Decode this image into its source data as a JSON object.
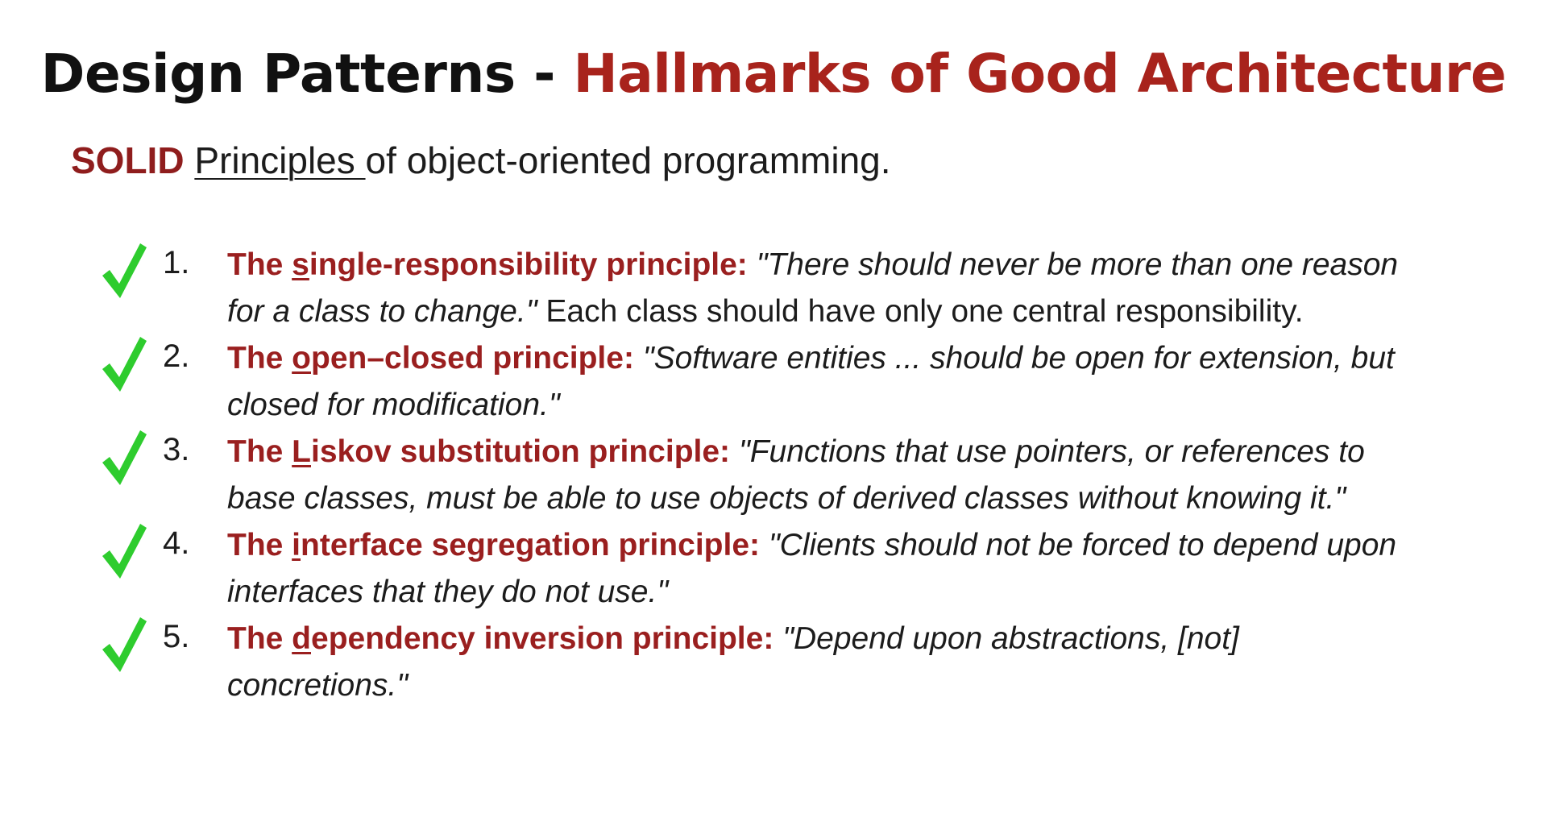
{
  "title": {
    "part1": "Design Patterns - ",
    "part2": "Hallmarks of Good Architecture"
  },
  "subtitle": {
    "solid": "SOLID",
    "principles": "Principles ",
    "rest": "of object-oriented programming."
  },
  "colors": {
    "accent_red": "#a8231c",
    "check_green": "#2ecc2e"
  },
  "principles": [
    {
      "number": "1.",
      "lead_pre": "The ",
      "lead_letter": "s",
      "lead_post": "ingle-responsibility principle:",
      "quote": " \"There should never be more than one reason for a class to change.\"",
      "rest": " Each class should have only one central responsibility."
    },
    {
      "number": "2.",
      "lead_pre": "The ",
      "lead_letter": "o",
      "lead_post": "pen–closed principle:",
      "quote": " \"Software entities ... should be open for extension, but closed for modification.\"",
      "rest": ""
    },
    {
      "number": "3.",
      "lead_pre": "The ",
      "lead_letter": "L",
      "lead_post": "iskov substitution principle:",
      "quote": " \"Functions that use pointers, or references to base classes, must be able to use objects of derived classes without knowing it.\"",
      "rest": ""
    },
    {
      "number": "4.",
      "lead_pre": "The ",
      "lead_letter": "i",
      "lead_post": "nterface segregation principle:",
      "quote": " \"Clients should not be forced to depend upon interfaces that they do not use.\"",
      "rest": ""
    },
    {
      "number": "5.",
      "lead_pre": "The ",
      "lead_letter": "d",
      "lead_post": "ependency inversion principle:",
      "quote": " \"Depend upon abstractions, [not] concretions.\"",
      "rest": ""
    }
  ],
  "icons": {
    "check": "checkmark-icon"
  }
}
